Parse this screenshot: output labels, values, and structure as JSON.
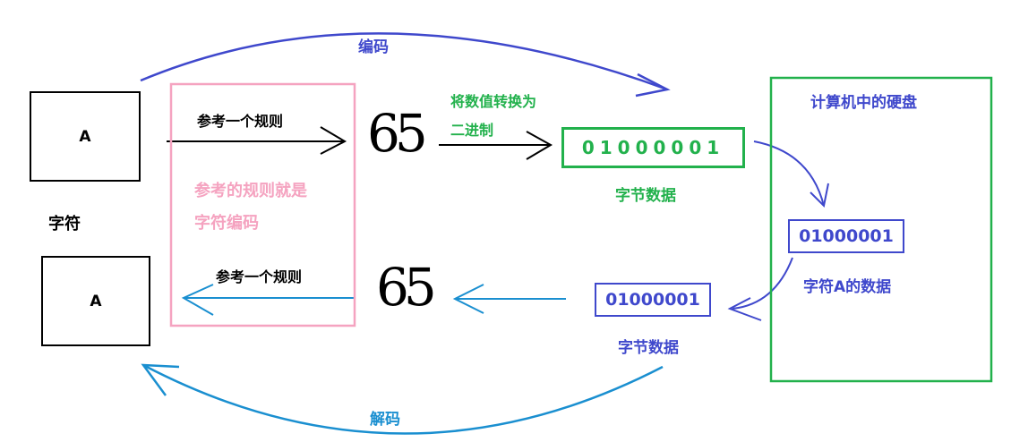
{
  "labels": {
    "encode": "编码",
    "decode": "解码",
    "char_a_top": "A",
    "char_a_bottom": "A",
    "character": "字符",
    "rule_top": "参考一个规则",
    "rule_bottom": "参考一个规则",
    "rule_note_line1": "参考的规则就是",
    "rule_note_line2": "字符编码",
    "num_top": "65",
    "num_bottom": "65",
    "convert_line1": "将数值转换为",
    "convert_line2": "二进制",
    "bits_green": "01000001",
    "byte_data_top": "字节数据",
    "byte_data_bottom": "字节数据",
    "disk_title": "计算机中的硬盘",
    "bits_disk": "01000001",
    "disk_data": "字符A的数据",
    "bits_bottom": "01000001"
  },
  "colors": {
    "encode_blue": "#3f48cc",
    "decode_cyan": "#1a8fd0",
    "binary_green": "#22b14c",
    "rule_pink": "#f5a3c0",
    "black": "#000000"
  }
}
